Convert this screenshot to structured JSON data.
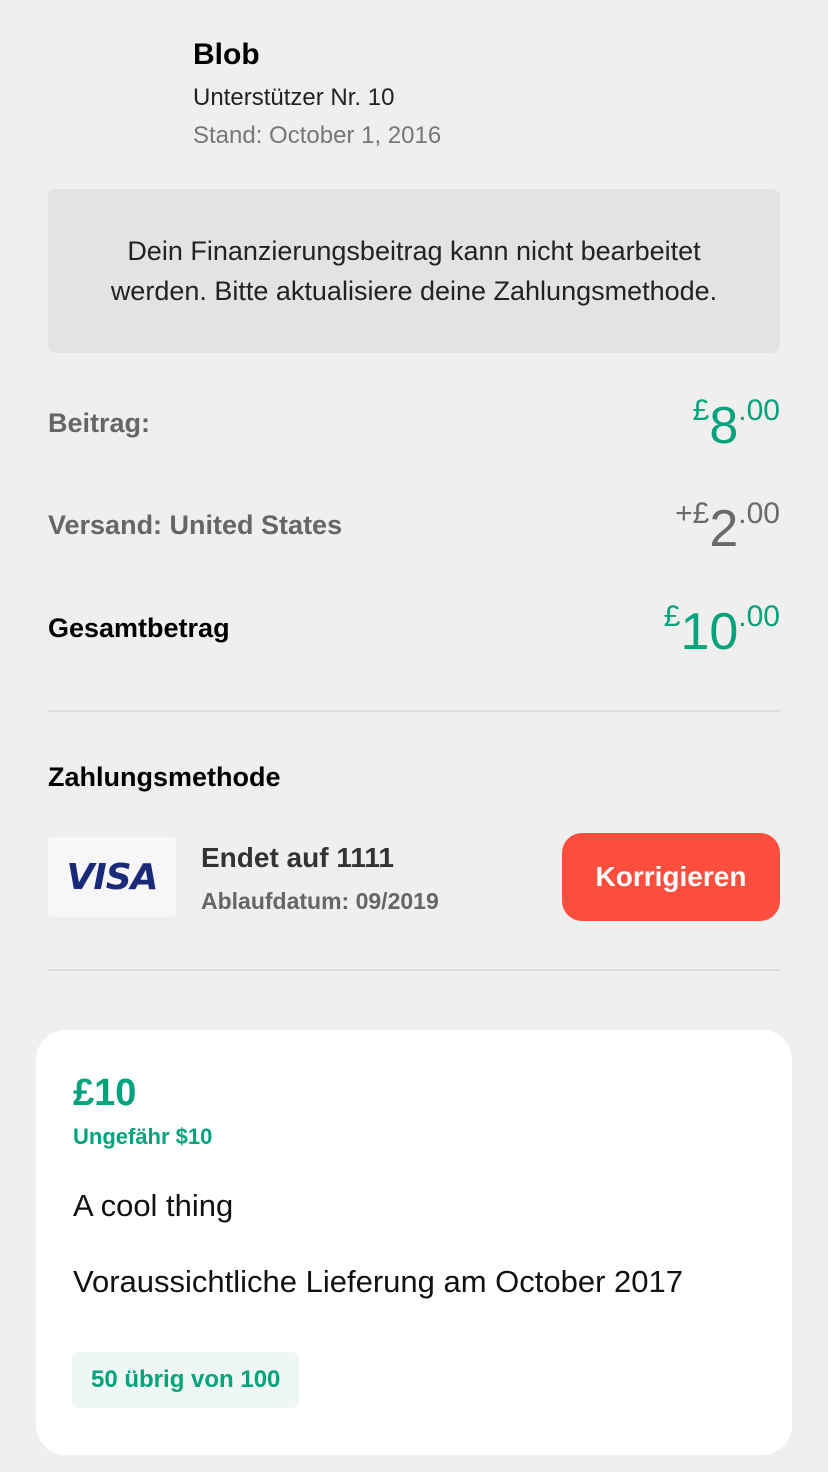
{
  "backer": {
    "name": "Blob",
    "number": "Unterstützer Nr. 10",
    "date": "Stand: October 1, 2016"
  },
  "notice": {
    "text": "Dein Finanzierungsbeitrag kann nicht bearbeitet werden. Bitte aktualisiere deine Zahlungsmethode."
  },
  "pledge": {
    "label": "Beitrag:",
    "symbol": "£",
    "integer": "8",
    "decimal": ".00"
  },
  "shipping": {
    "label": "Versand: United States",
    "symbol": "+£",
    "integer": "2",
    "decimal": ".00"
  },
  "total": {
    "label": "Gesamtbetrag",
    "symbol": "£",
    "integer": "10",
    "decimal": ".00"
  },
  "payment": {
    "title": "Zahlungsmethode",
    "brand": "VISA",
    "last_four": "Endet auf 1111",
    "expiration": "Ablaufdatum: 09/2019",
    "fix_label": "Korrigieren"
  },
  "reward": {
    "price": "£10",
    "approx": "Ungefähr $10",
    "title": "A cool thing",
    "delivery": "Voraussichtliche Lieferung am October 2017",
    "remaining": "50 übrig von 100"
  },
  "colors": {
    "accent_green": "#05a37b",
    "fix_red": "#ff4e3e",
    "background": "#efefef"
  }
}
